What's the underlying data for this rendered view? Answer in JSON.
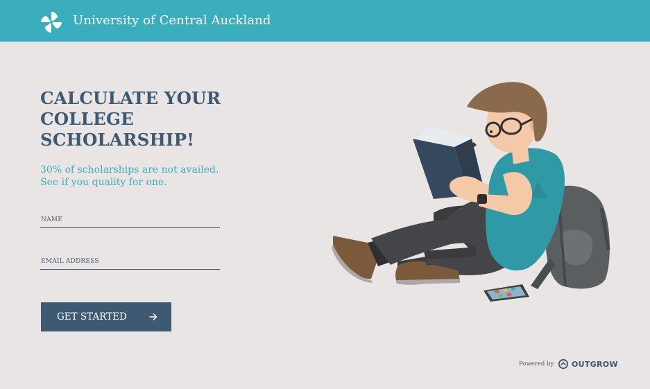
{
  "header": {
    "brand": "University of Central Auckland",
    "logo_icon": "pinwheel-icon",
    "background_color": "#3aaebd"
  },
  "hero": {
    "title_lines": [
      "CALCULATE YOUR",
      "COLLEGE",
      "SCHOLARSHIP!"
    ],
    "subtitle_lines": [
      "30% of scholarships are not availed.",
      "See if you quality for one."
    ]
  },
  "form": {
    "name_placeholder": "NAME",
    "name_value": "",
    "email_placeholder": "EMAIL ADDRESS",
    "email_value": "",
    "submit_label": "GET STARTED",
    "submit_icon": "arrow-right-icon"
  },
  "illustration": {
    "subject": "student-reading-illustration"
  },
  "footer": {
    "powered_by_label": "Powered by",
    "provider_name": "OUTGROW",
    "provider_icon": "outgrow-logo-icon"
  },
  "colors": {
    "accent": "#3aaebd",
    "primary": "#3d5a72",
    "background": "#e8e5e4"
  }
}
